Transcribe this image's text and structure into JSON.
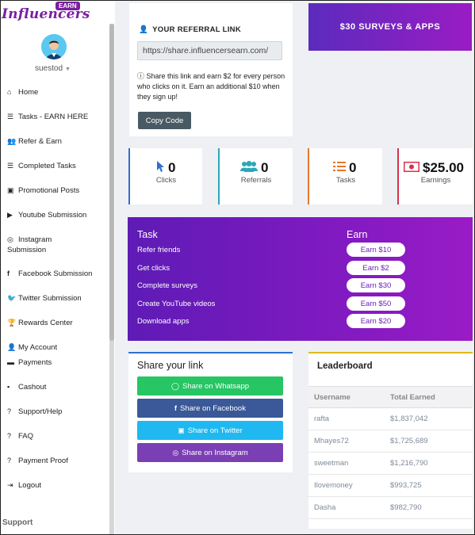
{
  "sidebar": {
    "logo_text": "Influencers",
    "logo_badge": "EARN",
    "user_name": "suestod",
    "user_caret": "▼",
    "items": [
      {
        "label": "Home",
        "icon": "home-icon",
        "glyph": "⌂"
      },
      {
        "label": "Tasks - EARN HERE",
        "icon": "list-icon",
        "glyph": "☰"
      },
      {
        "label": "Refer & Earn",
        "icon": "users-icon",
        "glyph": "👥"
      },
      {
        "label": "Completed Tasks",
        "icon": "list-check-icon",
        "glyph": "☰"
      },
      {
        "label": "Promotional Posts",
        "icon": "image-icon",
        "glyph": "▣"
      },
      {
        "label": "Youtube Submission",
        "icon": "youtube-icon",
        "glyph": "▶"
      },
      {
        "label": "Instagram",
        "label2": "Submission",
        "icon": "instagram-icon",
        "glyph": "◎"
      },
      {
        "label": "Facebook Submission",
        "icon": "facebook-icon",
        "glyph": "f"
      },
      {
        "label": "Twitter Submission",
        "icon": "twitter-icon",
        "glyph": "🐦"
      },
      {
        "label": "Rewards Center",
        "icon": "trophy-icon",
        "glyph": "🏆"
      },
      {
        "label": "My Account",
        "icon": "user-icon",
        "glyph": "👤"
      },
      {
        "label": "Payments",
        "icon": "payments-icon",
        "glyph": "▬"
      },
      {
        "label": "Cashout",
        "icon": "cashout-icon",
        "glyph": "▪"
      },
      {
        "label": "Support/Help",
        "icon": "help-icon",
        "glyph": "?"
      },
      {
        "label": "FAQ",
        "icon": "faq-icon",
        "glyph": "?"
      },
      {
        "label": "Payment Proof",
        "icon": "proof-icon",
        "glyph": "?"
      },
      {
        "label": "Logout",
        "icon": "logout-icon",
        "glyph": "⇥"
      }
    ],
    "support_label": "Support"
  },
  "referral": {
    "title": "YOUR REFERRAL LINK",
    "link": "https://share.influencersearn.com/",
    "description": "Share this link and earn $2 for every person who clicks on it. Earn an additional $10 when they sign up!",
    "copy_label": "Copy Code"
  },
  "promo": {
    "label": "$30 SURVEYS & APPS"
  },
  "stats": [
    {
      "value": "0",
      "label": "Clicks",
      "icon": "cursor-icon",
      "color": "#2f6fcf"
    },
    {
      "value": "0",
      "label": "Referrals",
      "icon": "users-icon",
      "color": "#2aa7b8"
    },
    {
      "value": "0",
      "label": "Tasks",
      "icon": "tasks-icon",
      "color": "#e8772a"
    },
    {
      "value": "$25.00",
      "label": "Earnings",
      "icon": "money-icon",
      "color": "#d9324a"
    }
  ],
  "tasks": {
    "task_heading": "Task",
    "earn_heading": "Earn",
    "rows": [
      {
        "task": "Refer friends",
        "earn": "Earn $10"
      },
      {
        "task": "Get clicks",
        "earn": "Earn $2"
      },
      {
        "task": "Complete surveys",
        "earn": "Earn $30"
      },
      {
        "task": "Create YouTube videos",
        "earn": "Earn $50"
      },
      {
        "task": "Download apps",
        "earn": "Earn $20"
      }
    ]
  },
  "share": {
    "title": "Share your link",
    "buttons": [
      {
        "label": "Share on Whatsapp",
        "icon": "whatsapp-icon",
        "color": "#25c663"
      },
      {
        "label": "Share on Facebook",
        "icon": "facebook-icon",
        "color": "#3b5998"
      },
      {
        "label": "Share on Twitter",
        "icon": "twitter-icon",
        "color": "#1fb8f0"
      },
      {
        "label": "Share on Instagram",
        "icon": "instagram-icon",
        "color": "#7b3fb4"
      }
    ]
  },
  "leaderboard": {
    "title": "Leaderboard",
    "col_user": "Username",
    "col_earned": "Total Earned",
    "rows": [
      {
        "user": "rafta",
        "earned": "$1,837,042"
      },
      {
        "user": "Mhayes72",
        "earned": "$1,725,689"
      },
      {
        "user": "sweetman",
        "earned": "$1,216,790"
      },
      {
        "user": "Ilovemoney",
        "earned": "$993,725"
      },
      {
        "user": "Dasha",
        "earned": "$982,790"
      }
    ]
  }
}
